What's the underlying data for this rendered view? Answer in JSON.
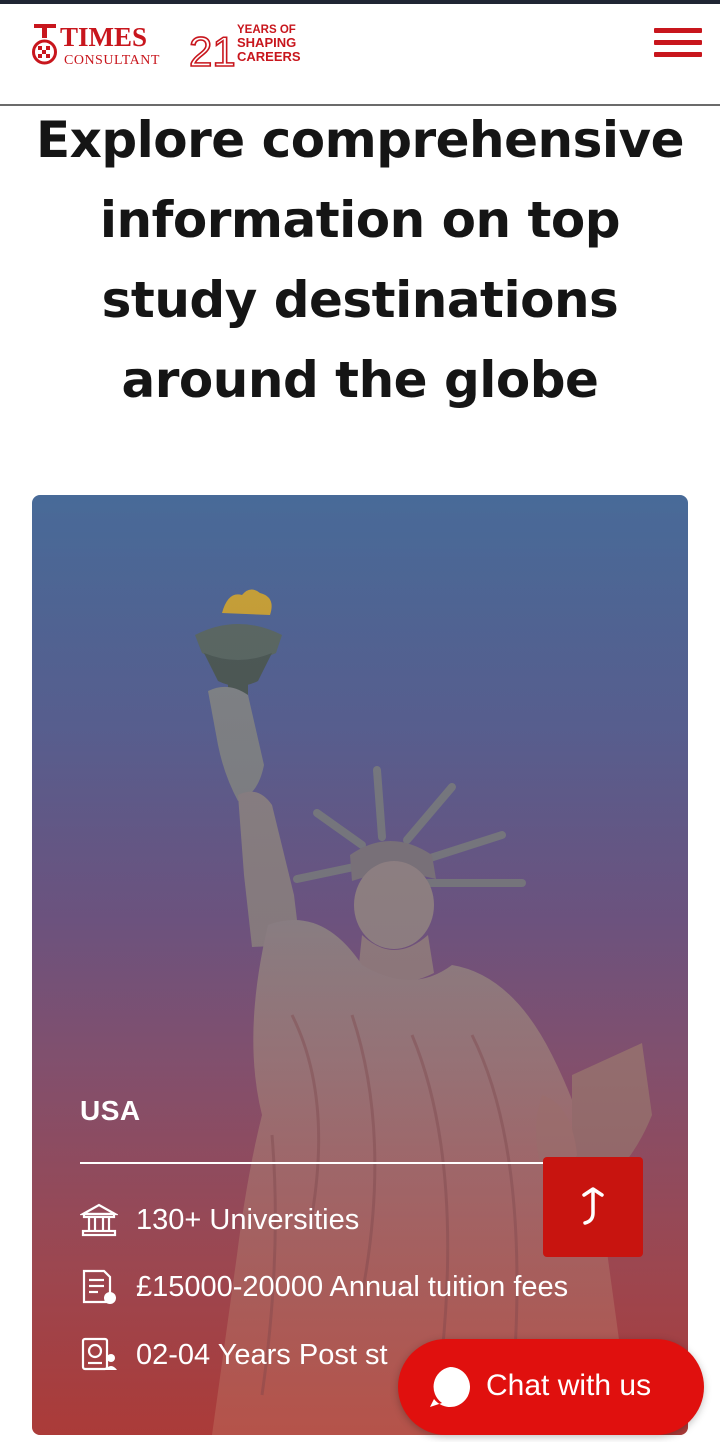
{
  "header": {
    "logo": {
      "brand": "TIMES",
      "sub": "CONSULTANT",
      "years_number": "21",
      "tagline": [
        "YEARS OF",
        "SHAPING",
        "CAREERS"
      ]
    },
    "menu_icon": "hamburger-menu-icon"
  },
  "heading": {
    "lines": [
      "Explore comprehensive",
      "information on top",
      "study destinations",
      "around the globe"
    ]
  },
  "card": {
    "country": "USA",
    "image": "statue-of-liberty",
    "features": [
      {
        "icon": "university-icon",
        "text": "130+ Universities"
      },
      {
        "icon": "document-fees-icon",
        "text": "£15000-20000 Annual tuition fees"
      },
      {
        "icon": "passport-visa-icon",
        "text": "02-04 Years Post st"
      }
    ],
    "share_icon": "share-arrow-icon"
  },
  "chat": {
    "label": "Chat with us",
    "icon": "chat-bubble-icon"
  },
  "colors": {
    "brand_red": "#c8161d",
    "chat_red": "#e0100e",
    "heading_text": "#151515"
  }
}
